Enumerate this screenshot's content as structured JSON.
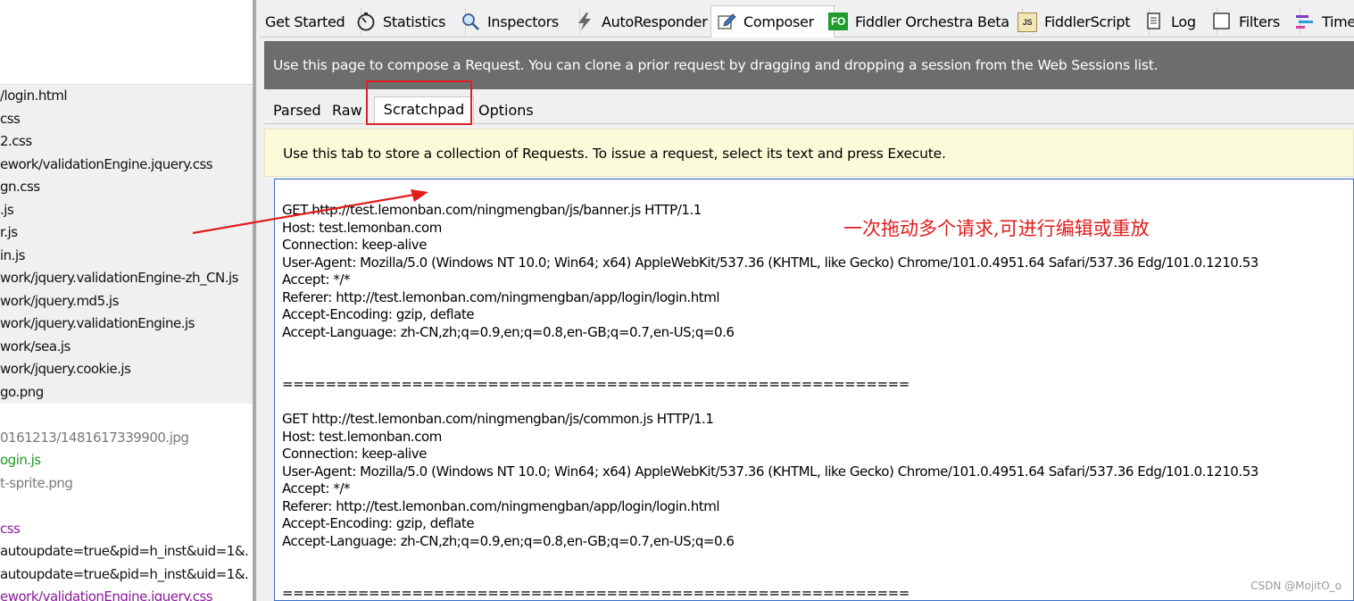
{
  "sessions": {
    "top_block": [
      {
        "text": "/login.html",
        "color": "black"
      },
      {
        "text": "css",
        "color": "black"
      },
      {
        "text": "2.css",
        "color": "black"
      },
      {
        "text": "ework/validationEngine.jquery.css",
        "color": "black"
      },
      {
        "text": "gn.css",
        "color": "black"
      },
      {
        "text": ".js",
        "color": "black"
      },
      {
        "text": "r.js",
        "color": "black"
      },
      {
        "text": "in.js",
        "color": "black"
      },
      {
        "text": "work/jquery.validationEngine-zh_CN.js",
        "color": "black"
      },
      {
        "text": "work/jquery.md5.js",
        "color": "black"
      },
      {
        "text": "work/jquery.validationEngine.js",
        "color": "black"
      },
      {
        "text": "work/sea.js",
        "color": "black"
      },
      {
        "text": "work/jquery.cookie.js",
        "color": "black"
      },
      {
        "text": "go.png",
        "color": "black"
      }
    ],
    "bottom_block": [
      {
        "text": "0161213/1481617339900.jpg",
        "color": "grey"
      },
      {
        "text": "ogin.js",
        "color": "green"
      },
      {
        "text": "t-sprite.png",
        "color": "grey"
      },
      {
        "text": "",
        "color": "grey"
      },
      {
        "text": "css",
        "color": "purple"
      },
      {
        "text": "autoupdate=true&pid=h_inst&uid=1&.",
        "color": "black"
      },
      {
        "text": "autoupdate=true&pid=h_inst&uid=1&.",
        "color": "black"
      },
      {
        "text": "ework/validationEngine.jquery.css",
        "color": "purple"
      }
    ]
  },
  "tabs": [
    {
      "label": "Get Started",
      "icon": "none"
    },
    {
      "label": "Statistics",
      "icon": "stopwatch-icon"
    },
    {
      "label": "Inspectors",
      "icon": "magnifier-icon"
    },
    {
      "label": "AutoResponder",
      "icon": "lightning-icon"
    },
    {
      "label": "Composer",
      "icon": "pencil-icon",
      "active": true
    },
    {
      "label": "Fiddler Orchestra Beta",
      "icon": "fo-icon",
      "icon_text": "FO"
    },
    {
      "label": "FiddlerScript",
      "icon": "js-icon",
      "icon_text": "JS"
    },
    {
      "label": "Log",
      "icon": "log-icon"
    },
    {
      "label": "Filters",
      "icon": "checkbox-icon"
    },
    {
      "label": "Timeline",
      "icon": "timeline-icon"
    }
  ],
  "banner": "Use this page to compose a Request. You can clone a prior request by dragging and dropping a session from the Web Sessions list.",
  "subtabs": [
    {
      "label": "Parsed"
    },
    {
      "label": "Raw"
    },
    {
      "label": "Scratchpad",
      "active": true
    },
    {
      "label": "Options"
    }
  ],
  "hint": "Use this tab to store a collection of Requests. To issue a request, select its text and press Execute.",
  "editor_lines": [
    "GET http://test.lemonban.com/ningmengban/js/banner.js HTTP/1.1",
    "Host: test.lemonban.com",
    "Connection: keep-alive",
    "User-Agent: Mozilla/5.0 (Windows NT 10.0; Win64; x64) AppleWebKit/537.36 (KHTML, like Gecko) Chrome/101.0.4951.64 Safari/537.36 Edg/101.0.1210.53",
    "Accept: */*",
    "Referer: http://test.lemonban.com/ningmengban/app/login/login.html",
    "Accept-Encoding: gzip, deflate",
    "Accept-Language: zh-CN,zh;q=0.9,en;q=0.8,en-GB;q=0.7,en-US;q=0.6",
    "",
    "",
    "==========================================================",
    "",
    "GET http://test.lemonban.com/ningmengban/js/common.js HTTP/1.1",
    "Host: test.lemonban.com",
    "Connection: keep-alive",
    "User-Agent: Mozilla/5.0 (Windows NT 10.0; Win64; x64) AppleWebKit/537.36 (KHTML, like Gecko) Chrome/101.0.4951.64 Safari/537.36 Edg/101.0.1210.53",
    "Accept: */*",
    "Referer: http://test.lemonban.com/ningmengban/app/login/login.html",
    "Accept-Encoding: gzip, deflate",
    "Accept-Language: zh-CN,zh;q=0.9,en;q=0.8,en-GB;q=0.7,en-US;q=0.6",
    "",
    "",
    "=========================================================="
  ],
  "annotation": "一次拖动多个请求,可进行编辑或重放",
  "watermark": "CSDN @MojitO_o",
  "colors": {
    "annotation_red": "#e01d1d",
    "banner_bg": "#6d6d6d",
    "hint_bg": "#fbfbd9",
    "editor_border": "#3a6fc4"
  }
}
